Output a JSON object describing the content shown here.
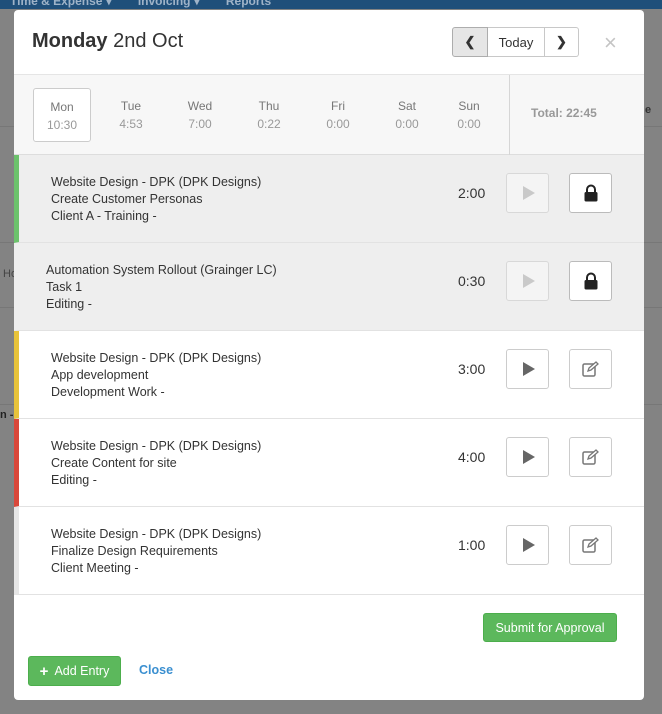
{
  "background": {
    "nav": [
      "Time & Expense ▾",
      "Invoicing ▾",
      "Reports"
    ],
    "fragments": [
      "Ho",
      "n -",
      "e"
    ]
  },
  "modal": {
    "title_day": "Monday",
    "title_date": "2nd Oct",
    "today_label": "Today",
    "close_glyph": "×",
    "prev_glyph": "❮",
    "next_glyph": "❯"
  },
  "week": {
    "days": [
      {
        "name": "Mon",
        "time": "10:30"
      },
      {
        "name": "Tue",
        "time": "4:53"
      },
      {
        "name": "Wed",
        "time": "7:00"
      },
      {
        "name": "Thu",
        "time": "0:22"
      },
      {
        "name": "Fri",
        "time": "0:00"
      },
      {
        "name": "Sat",
        "time": "0:00"
      },
      {
        "name": "Sun",
        "time": "0:00"
      }
    ],
    "active_day": "Mon",
    "total": "Total: 22:45"
  },
  "entries": [
    {
      "project": "Website Design - DPK (DPK Designs)",
      "task": "Create Customer Personas",
      "category": "Client A - Training -",
      "duration": "2:00",
      "locked": true,
      "color": "#6cc26c",
      "action_icon": "lock-icon"
    },
    {
      "project": "Automation System Rollout (Grainger LC)",
      "task": "Task 1",
      "category": "Editing -",
      "duration": "0:30",
      "locked": true,
      "color": "#eeeeee",
      "action_icon": "lock-icon"
    },
    {
      "project": "Website Design - DPK (DPK Designs)",
      "task": "App development",
      "category": "Development Work -",
      "duration": "3:00",
      "locked": false,
      "color": "#e8c33a",
      "action_icon": "edit-icon"
    },
    {
      "project": "Website Design - DPK (DPK Designs)",
      "task": "Create Content for site",
      "category": "Editing -",
      "duration": "4:00",
      "locked": false,
      "color": "#d9473a",
      "action_icon": "edit-icon"
    },
    {
      "project": "Website Design - DPK (DPK Designs)",
      "task": "Finalize Design Requirements",
      "category": "Client Meeting -",
      "duration": "1:00",
      "locked": false,
      "color": "#e6e6e6",
      "action_icon": "edit-icon"
    }
  ],
  "footer": {
    "submit_label": "Submit for Approval",
    "add_label": "Add Entry",
    "close_label": "Close"
  },
  "colors": {
    "accent_green": "#5cb85c",
    "link_blue": "#3a8fd0"
  }
}
